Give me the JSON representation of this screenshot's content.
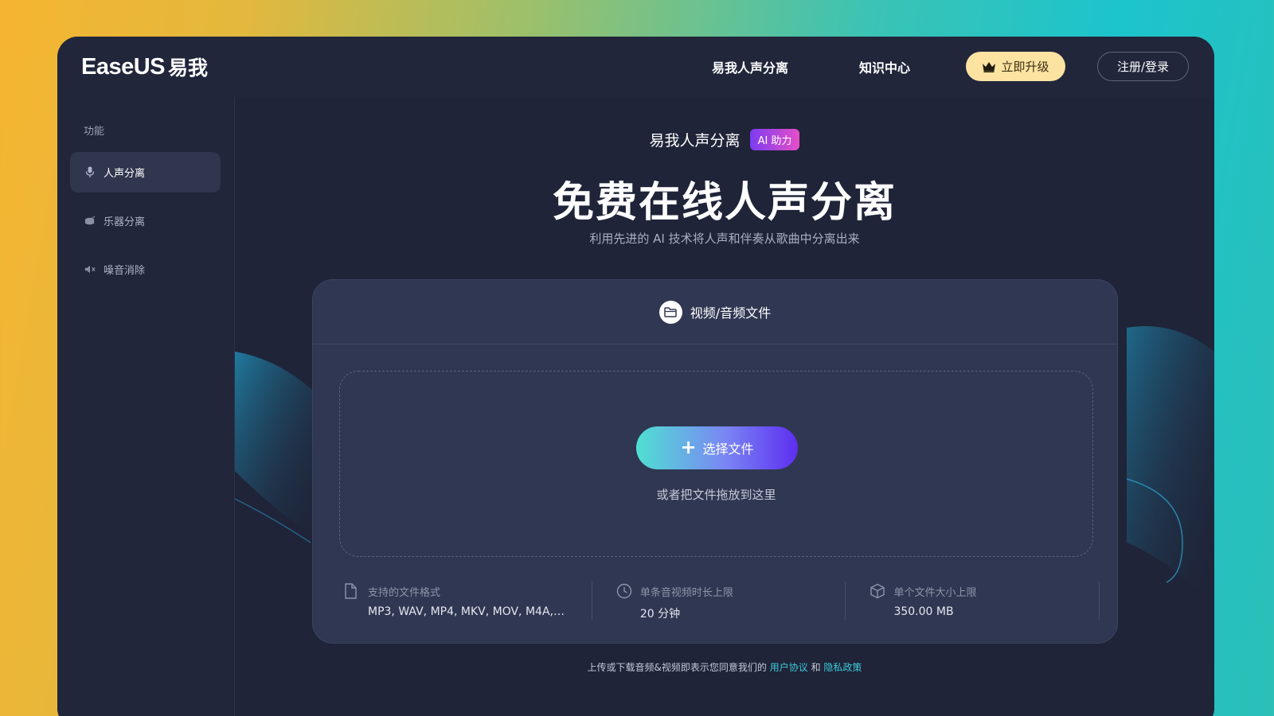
{
  "header": {
    "logo_text": "EaseUS",
    "logo_cn": "易我",
    "nav": [
      "易我人声分离",
      "知识中心"
    ],
    "upgrade_label": "立即升级",
    "login_label": "注册/登录"
  },
  "sidebar": {
    "title": "功能",
    "items": [
      {
        "label": "人声分离",
        "icon": "microphone-icon",
        "active": true
      },
      {
        "label": "乐器分离",
        "icon": "drum-icon",
        "active": false
      },
      {
        "label": "噪音消除",
        "icon": "speaker-noise-icon",
        "active": false
      }
    ]
  },
  "main": {
    "product_name": "易我人声分离",
    "ai_badge": "AI 助力",
    "hero_title": "免费在线人声分离",
    "subtitle": "利用先进的 AI 技术将人声和伴奏从歌曲中分离出来",
    "tab_label": "视频/音频文件",
    "choose_label": "选择文件",
    "drop_hint": "或者把文件拖放到这里",
    "info": [
      {
        "label": "支持的文件格式",
        "value": "MP3, WAV, MP4, MKV, MOV, M4A, ...",
        "icon": "file-icon"
      },
      {
        "label": "单条音视频时长上限",
        "value": "20 分钟",
        "icon": "clock-icon"
      },
      {
        "label": "单个文件大小上限",
        "value": "350.00 MB",
        "icon": "box-icon"
      }
    ],
    "footer_prefix": "上传或下载音频&视频即表示您同意我们的",
    "footer_link1": "用户协议",
    "footer_and": "和",
    "footer_link2": "隐私政策"
  },
  "colors": {
    "accent_teal": "#3cc9d8",
    "upgrade_bg": "#fde3a1",
    "support_bg": "#6b4ee6"
  }
}
